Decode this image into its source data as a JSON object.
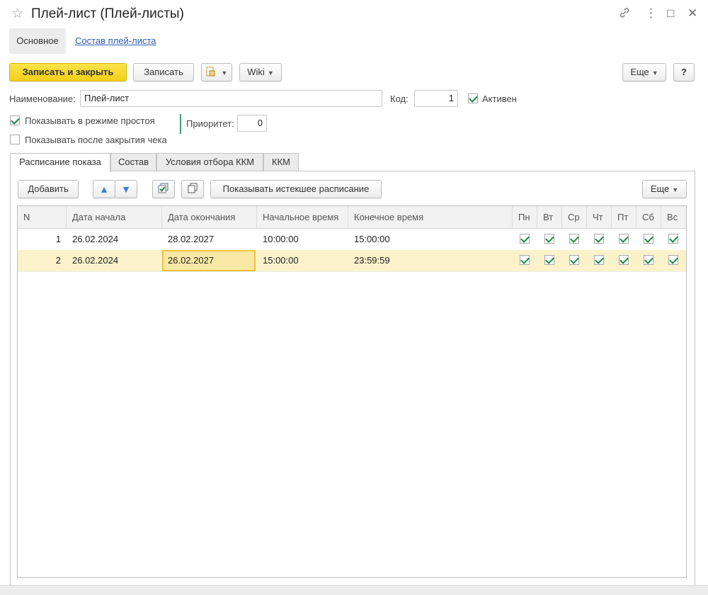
{
  "window": {
    "title": "Плей-лист (Плей-листы)",
    "controls": {
      "link_icon": "link-icon",
      "more_icon": "⋮",
      "maximize_icon": "□",
      "close_icon": "✕"
    }
  },
  "nav": {
    "main": "Основное",
    "composition_link": "Состав плей-листа"
  },
  "toolbar": {
    "save_close": "Записать и закрыть",
    "save": "Записать",
    "wiki": "Wiki",
    "more": "Еще",
    "help": "?"
  },
  "form": {
    "name_label": "Наименование:",
    "name_value": "Плей-лист",
    "code_label": "Код:",
    "code_value": "1",
    "active_label": "Активен",
    "active_checked": true,
    "idle_label": "Показывать в режиме простоя",
    "idle_checked": true,
    "after_receipt_label": "Показывать после закрытия чека",
    "after_receipt_checked": false,
    "priority_label": "Приоритет:",
    "priority_value": "0"
  },
  "tabs": [
    "Расписание показа",
    "Состав",
    "Условия отбора ККМ",
    "ККМ"
  ],
  "table_toolbar": {
    "add": "Добавить",
    "show_expired": "Показывать истекшее расписание",
    "more": "Еще"
  },
  "table": {
    "columns": [
      "N",
      "Дата начала",
      "Дата окончания",
      "Начальное время",
      "Конечное время",
      "Пн",
      "Вт",
      "Ср",
      "Чт",
      "Пт",
      "Сб",
      "Вс"
    ],
    "rows": [
      {
        "n": "1",
        "start_date": "26.02.2024",
        "end_date": "28.02.2027",
        "start_time": "10:00:00",
        "end_time": "15:00:00",
        "days": [
          true,
          true,
          true,
          true,
          true,
          true,
          true
        ]
      },
      {
        "n": "2",
        "start_date": "26.02.2024",
        "end_date": "26.02.2027",
        "start_time": "15:00:00",
        "end_time": "23:59:59",
        "days": [
          true,
          true,
          true,
          true,
          true,
          true,
          true
        ]
      }
    ]
  },
  "colors": {
    "primary_button": "#f3cf1a",
    "selected_row": "#fbf2cc",
    "link": "#2a5db0",
    "check": "#1d8a4a"
  }
}
